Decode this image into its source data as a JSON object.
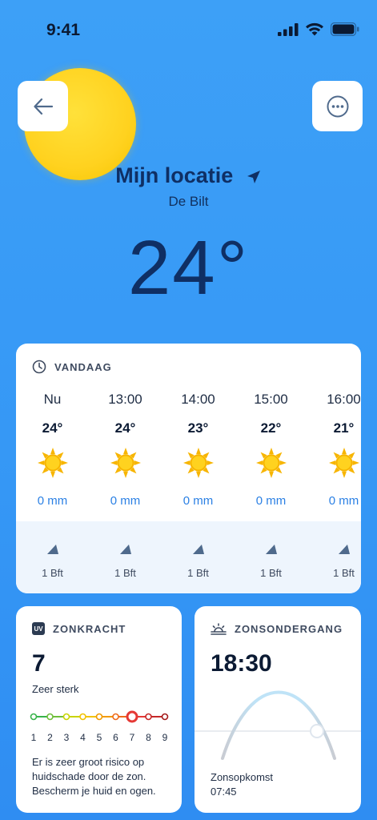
{
  "status": {
    "time": "9:41"
  },
  "location": {
    "title": "Mijn locatie",
    "subtitle": "De Bilt",
    "temperature": "24°"
  },
  "today": {
    "heading": "VANDAAG",
    "hours": [
      {
        "label": "Nu",
        "temp": "24°",
        "rain": "0 mm",
        "wind": "1 Bft",
        "icon": "sun-icon"
      },
      {
        "label": "13:00",
        "temp": "24°",
        "rain": "0 mm",
        "wind": "1 Bft",
        "icon": "sun-icon"
      },
      {
        "label": "14:00",
        "temp": "23°",
        "rain": "0 mm",
        "wind": "1 Bft",
        "icon": "sun-icon"
      },
      {
        "label": "15:00",
        "temp": "22°",
        "rain": "0 mm",
        "wind": "1 Bft",
        "icon": "sun-icon"
      },
      {
        "label": "16:00",
        "temp": "21°",
        "rain": "0 mm",
        "wind": "1 Bft",
        "icon": "sun-icon"
      }
    ]
  },
  "uv": {
    "badge": "UV",
    "heading": "ZONKRACHT",
    "value": "7",
    "level": "Zeer sterk",
    "scale": [
      "1",
      "2",
      "3",
      "4",
      "5",
      "6",
      "7",
      "8",
      "9"
    ],
    "current_index": 7,
    "description": "Er is zeer groot risico op huidschade door de zon. Bescherm je huid en ogen.",
    "colors": [
      "#37b34a",
      "#6fbf3a",
      "#c9d400",
      "#f2c300",
      "#f29b00",
      "#ee6a1a",
      "#e53935",
      "#c62828",
      "#a31b1b"
    ]
  },
  "sunset": {
    "heading": "ZONSONDERGANG",
    "time": "18:30",
    "sunrise_label": "Zonsopkomst",
    "sunrise_time": "07:45"
  },
  "colors": {
    "background": "#3597f5",
    "accent_blue": "#2b80e4",
    "sun_yellow": "#ffd21f",
    "dark_navy": "#0f2f64"
  }
}
